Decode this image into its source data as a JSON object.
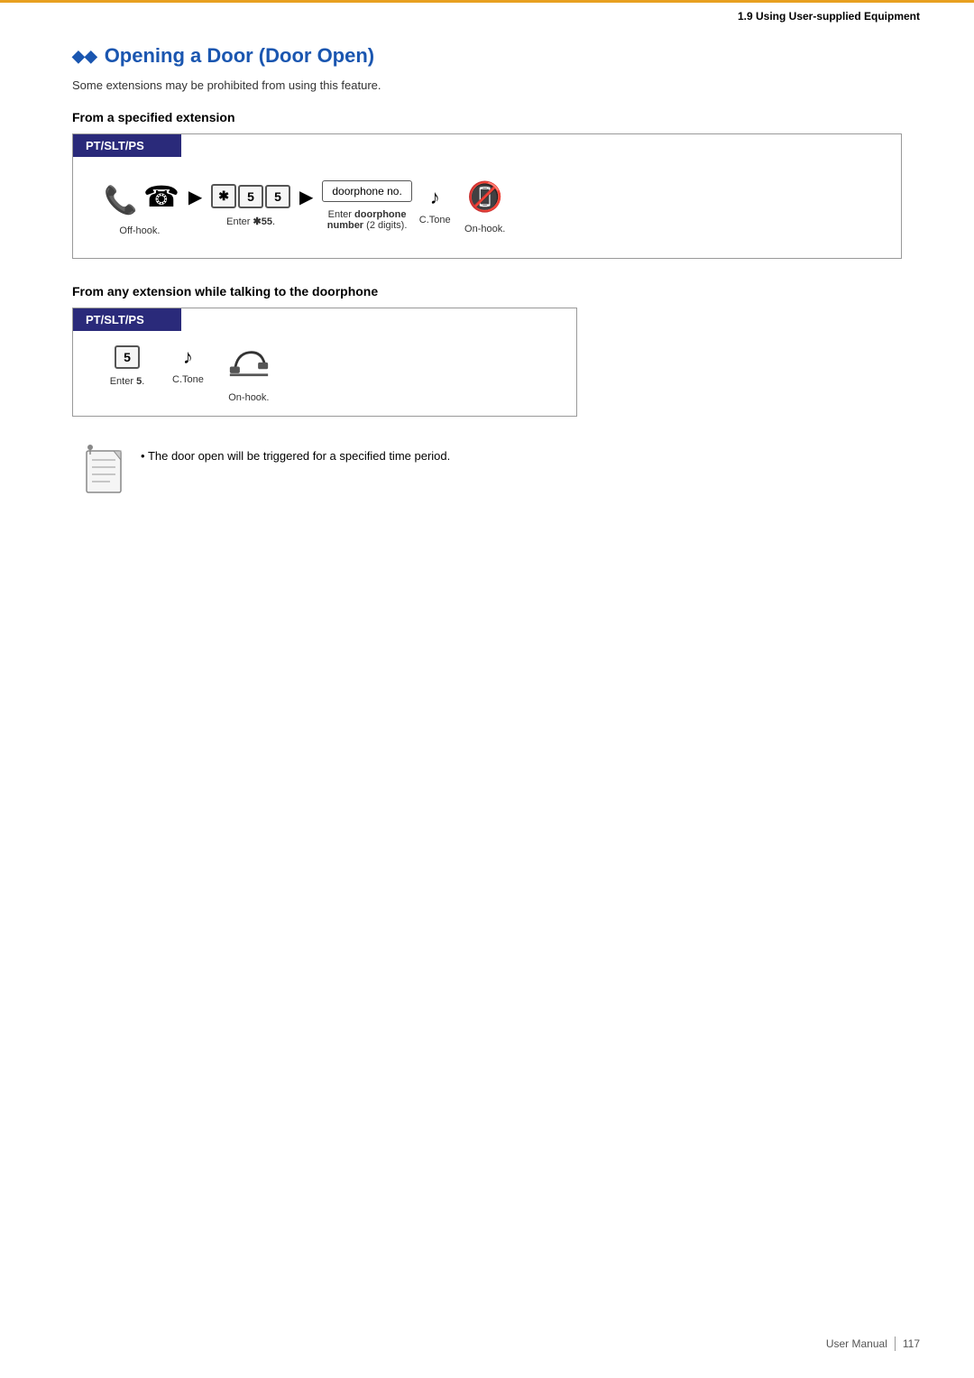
{
  "header": {
    "section": "1.9 Using User-supplied Equipment"
  },
  "page": {
    "title_icons": "◆◆",
    "title": "Opening a Door (Door Open)",
    "subtitle": "Some extensions may be prohibited from using this feature.",
    "section1_heading": "From a specified extension",
    "section2_heading": "From any extension while talking to the doorphone",
    "diagram1_label": "PT/SLT/PS",
    "diagram2_label": "PT/SLT/PS",
    "step1_offhook_label": "Off-hook.",
    "step1_enter_label": "Enter ✱55.",
    "step1_doorphone_label": "Enter doorphone",
    "step1_doorphone_label2": "number (2 digits).",
    "step1_onhook_label": "On-hook.",
    "step2_enter5_label": "Enter 5.",
    "step2_onhook_label": "On-hook.",
    "ctone_label": "C.Tone",
    "doorphone_no_text": "doorphone no.",
    "key_star": "✱",
    "key_5a": "5",
    "key_5b": "5",
    "key_5": "5",
    "note_text": "The door open will be triggered for a specified time period."
  },
  "footer": {
    "label": "User Manual",
    "page": "117"
  }
}
